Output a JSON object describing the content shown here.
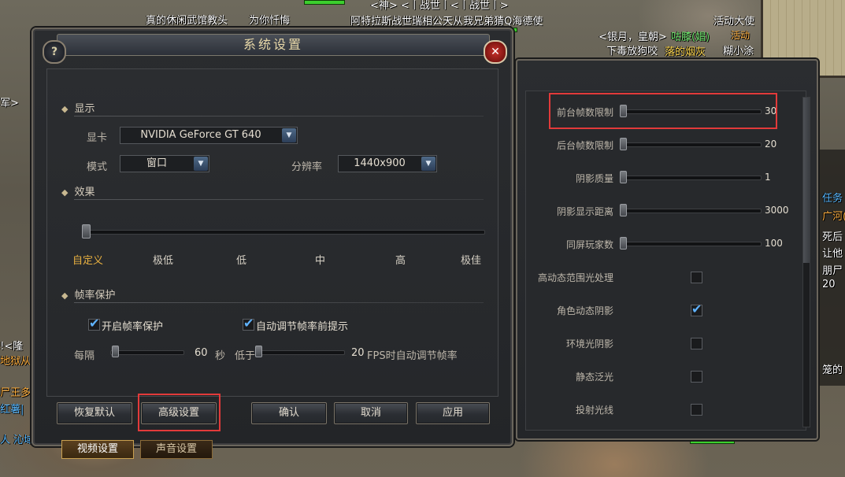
{
  "game_hud": {
    "names": [
      "<神> <丨战世丨<丨战世丨>",
      "真的休闲武馆教头",
      "为你忏悔",
      "阿特拉斯战世瑞相公天从我兄弟猜Q海德使",
      "活动大使",
      "<银月，皇朝>",
      "咕膝(娼)",
      "活动",
      "下毒放狗咬",
      "落的烟灰",
      "糊小涂"
    ],
    "left_fragments": [
      "军>",
      "!<隆",
      "地狱从",
      "尸王多",
      "红薯|",
      "人 沁域"
    ],
    "right_fragments": [
      "任务",
      "广河(",
      "死后",
      "让他",
      "朋尸",
      "20",
      "笼的"
    ]
  },
  "dialog": {
    "title": "系统设置",
    "help_icon": "?",
    "close_icon": "✕",
    "sections": {
      "display": "显示",
      "effects": "效果",
      "frame_protect": "帧率保护"
    },
    "display": {
      "gpu_label": "显卡",
      "gpu_value": "NVIDIA GeForce GT 640",
      "mode_label": "模式",
      "mode_value": "窗口",
      "resolution_label": "分辨率",
      "resolution_value": "1440x900"
    },
    "effects": {
      "levels": [
        "自定义",
        "极低",
        "低",
        "中",
        "高",
        "极佳"
      ],
      "selected_index": 0
    },
    "frame_protect": {
      "enable_label": "开启帧率保护",
      "enable_checked": true,
      "auto_label": "自动调节帧率前提示",
      "auto_checked": true,
      "interval_label": "每隔",
      "interval_value": "60",
      "interval_unit": "秒",
      "below_label": "低于",
      "fps_value": "20",
      "fps_suffix": "FPS时自动调节帧率"
    },
    "buttons": {
      "restore": "恢复默认",
      "advanced": "高级设置",
      "ok": "确认",
      "cancel": "取消",
      "apply": "应用"
    },
    "tabs": {
      "video": "视频设置",
      "audio": "声音设置"
    }
  },
  "advanced_panel": {
    "sliders": [
      {
        "label": "前台帧数限制",
        "value": "30"
      },
      {
        "label": "后台帧数限制",
        "value": "20"
      },
      {
        "label": "阴影质量",
        "value": "1"
      },
      {
        "label": "阴影显示距离",
        "value": "3000"
      },
      {
        "label": "同屏玩家数",
        "value": "100"
      }
    ],
    "checks": [
      {
        "label": "高动态范围光处理",
        "checked": false
      },
      {
        "label": "角色动态阴影",
        "checked": true
      },
      {
        "label": "环境光阴影",
        "checked": false
      },
      {
        "label": "静态泛光",
        "checked": false
      },
      {
        "label": "投射光线",
        "checked": false
      }
    ]
  },
  "colors": {
    "highlight": "#e23a3a",
    "selected_effect": "#e8b040",
    "checkmark": "#5fb2ff"
  }
}
